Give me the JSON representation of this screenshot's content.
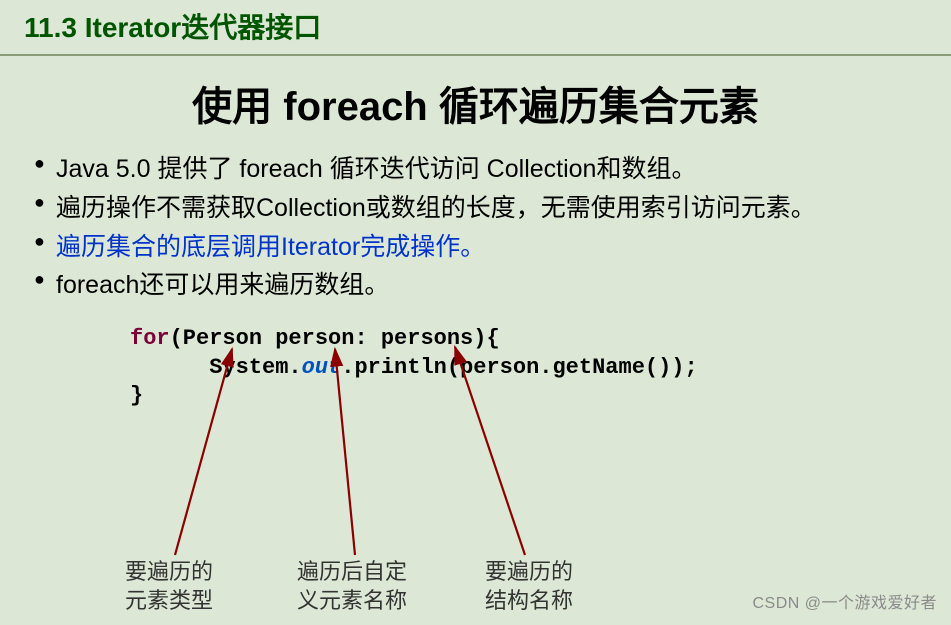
{
  "header": {
    "title": "11.3 Iterator迭代器接口"
  },
  "title": {
    "pre": "使用 ",
    "kw": "foreach",
    "post": " 循环遍历集合元素"
  },
  "bullets": [
    "Java 5.0 提供了 foreach 循环迭代访问 Collection和数组。",
    "遍历操作不需获取Collection或数组的长度，无需使用索引访问元素。",
    "遍历集合的底层调用Iterator完成操作。",
    "foreach还可以用来遍历数组。"
  ],
  "code": {
    "kw_for": "for",
    "par1": "(Person person: persons){",
    "indent": "      System.",
    "out": "out",
    "rest": ".println(person.getName());",
    "brace": "}"
  },
  "labels": {
    "l1a": "要遍历的",
    "l1b": "元素类型",
    "l2a": "遍历后自定",
    "l2b": "义元素名称",
    "l3a": "要遍历的",
    "l3b": "结构名称"
  },
  "watermark": "CSDN @一个游戏爱好者"
}
